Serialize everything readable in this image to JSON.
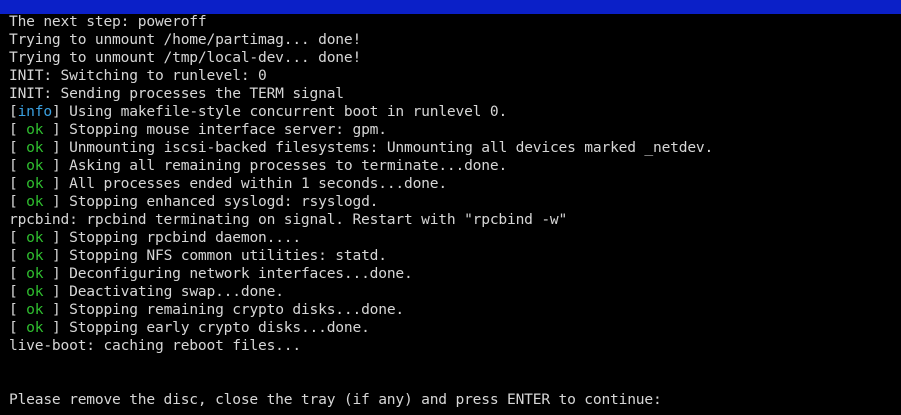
{
  "colors": {
    "background": "#000000",
    "title_bar": "#0b20c8",
    "text": "#d6d6d6",
    "ok": "#2fbf2f",
    "info": "#3aa0e0"
  },
  "console": {
    "lines": [
      {
        "text": "The next step: poweroff"
      },
      {
        "text": "Trying to unmount /home/partimag... done!"
      },
      {
        "text": "Trying to unmount /tmp/local-dev... done!"
      },
      {
        "text": "INIT: Switching to runlevel: 0"
      },
      {
        "text": "INIT: Sending processes the TERM signal"
      },
      {
        "tag": "info",
        "text": " Using makefile-style concurrent boot in runlevel 0."
      },
      {
        "tag": " ok ",
        "text": " Stopping mouse interface server: gpm."
      },
      {
        "tag": " ok ",
        "text": " Unmounting iscsi-backed filesystems: Unmounting all devices marked _netdev."
      },
      {
        "tag": " ok ",
        "text": " Asking all remaining processes to terminate...done."
      },
      {
        "tag": " ok ",
        "text": " All processes ended within 1 seconds...done."
      },
      {
        "tag": " ok ",
        "text": " Stopping enhanced syslogd: rsyslogd."
      },
      {
        "text": "rpcbind: rpcbind terminating on signal. Restart with \"rpcbind -w\""
      },
      {
        "tag": " ok ",
        "text": " Stopping rpcbind daemon...."
      },
      {
        "tag": " ok ",
        "text": " Stopping NFS common utilities: statd."
      },
      {
        "tag": " ok ",
        "text": " Deconfiguring network interfaces...done."
      },
      {
        "tag": " ok ",
        "text": " Deactivating swap...done."
      },
      {
        "tag": " ok ",
        "text": " Stopping remaining crypto disks...done."
      },
      {
        "tag": " ok ",
        "text": " Stopping early crypto disks...done."
      },
      {
        "text": "live-boot: caching reboot files..."
      },
      {
        "text": ""
      },
      {
        "text": ""
      },
      {
        "text": "Please remove the disc, close the tray (if any) and press ENTER to continue:"
      }
    ]
  }
}
